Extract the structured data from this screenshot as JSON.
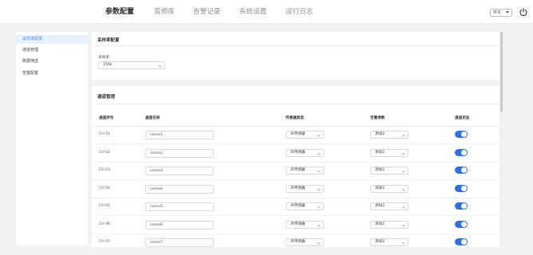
{
  "nav": {
    "tabs": [
      {
        "label": "参数配置",
        "active": true
      },
      {
        "label": "音频库",
        "active": false
      },
      {
        "label": "告警记录",
        "active": false
      },
      {
        "label": "系统设置",
        "active": false
      },
      {
        "label": "运行日志",
        "active": false
      }
    ],
    "language": "中文",
    "power_icon": "power-icon"
  },
  "sidebar": {
    "items": [
      {
        "label": "采样率配置",
        "active": true
      },
      {
        "label": "通道管理",
        "active": false
      },
      {
        "label": "数据筛选",
        "active": false
      },
      {
        "label": "告警配置",
        "active": false
      }
    ]
  },
  "sampling": {
    "title": "采样率配置",
    "field_label": "采样率:",
    "value": "150k"
  },
  "channels": {
    "title": "通道管理",
    "headers": [
      "通道序号",
      "通道名称",
      "传感器类型",
      "告警参数",
      "通道状态"
    ],
    "rows": [
      {
        "id": "CH 01",
        "name": "name1",
        "sensor": "声传感器",
        "alarm": "测试2",
        "enabled": true
      },
      {
        "id": "CH 02",
        "name": "name2",
        "sensor": "声传感器",
        "alarm": "测试2",
        "enabled": true
      },
      {
        "id": "CH 03",
        "name": "name3",
        "sensor": "声传感器",
        "alarm": "测试2",
        "enabled": true
      },
      {
        "id": "CH 04",
        "name": "name4",
        "sensor": "声传感器",
        "alarm": "测试2",
        "enabled": true
      },
      {
        "id": "CH 05",
        "name": "name5",
        "sensor": "声传感器",
        "alarm": "测试2",
        "enabled": true
      },
      {
        "id": "CH 06",
        "name": "name6",
        "sensor": "声传感器",
        "alarm": "测试2",
        "enabled": true
      },
      {
        "id": "CH 07",
        "name": "name7",
        "sensor": "声传感器",
        "alarm": "测试2",
        "enabled": true
      }
    ]
  },
  "colors": {
    "accent": "#2f6fe0",
    "sidebar_active_bg": "#e6f0ff",
    "sidebar_active_text": "#5b8def"
  }
}
